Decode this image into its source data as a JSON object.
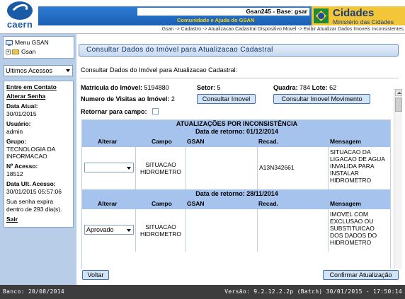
{
  "header": {
    "logo_text": "caern",
    "system_title": "Gsan245 - Base: gsar",
    "community_link": "Comunidade e Ajuda do GSAN",
    "ministry_name": "Cidades",
    "ministry_sub": "Ministério das Cidades",
    "breadcrumb": "Gsan -> Cadastro -> Atualizacao Cadastral Dispositivo Movel -> Exibir Atualizar Dados Imoveis Inconsistentes"
  },
  "sidebar": {
    "menu_root": "Menu GSAN",
    "menu_child": "Gsan",
    "recent_select": "Ultimos Acessos",
    "contact_link": "Entre em Contato",
    "change_password_link": "Alterar Senha",
    "date_label": "Data Atual:",
    "date_value": "30/01/2015",
    "user_label": "Usuário:",
    "user_value": "admin",
    "group_label": "Grupo:",
    "group_value_1": "TECNOLOGIA DA",
    "group_value_2": "INFORMACAO",
    "access_count_label": "Nº Acesso:",
    "access_count_value": "18512",
    "last_access_label": "Data Ult. Acesso:",
    "last_access_value": "30/01/2015 05:57:06",
    "password_expiry_1": "Sua senha expira",
    "password_expiry_2": "dentro de 293 dia(s).",
    "logout_link": "Sair"
  },
  "main": {
    "panel_title": "Consultar Dados do Imóvel para Atualizacao Cadastral",
    "subtitle": "Consultar Dados do Imóvel para Atualizacao Cadastral:",
    "matricula_label": "Matricula do Imóvel:",
    "matricula_value": "5194880",
    "setor_label": "Setor:",
    "setor_value": "5",
    "quadra_label": "Quadra:",
    "quadra_value": "784",
    "lote_label": "Lote:",
    "lote_value": "62",
    "visits_label": "Numero de Visitas ao Imóvel:",
    "visits_value": "2",
    "btn_consultar_imovel": "Consultar Imovel",
    "btn_consultar_movimento": "Consultar Imovel Movimento",
    "return_label": "Retornar para campo:",
    "table": {
      "title": "ATUALIZAÇÕES POR INCONSISTÊNCIA",
      "groups": [
        {
          "date_header": "Data de retorno: 01/12/2014",
          "headers": [
            "Alterar",
            "Campo",
            "GSAN",
            "Recad.",
            "Mensagem"
          ],
          "row": {
            "alterar": "",
            "campo_1": "SITUACAO",
            "campo_2": "HIDROMETRO",
            "gsan": "",
            "recad": "A13N342661",
            "mensagem_1": "SITUACAO DA",
            "mensagem_2": "LIGACAO DE AGUA",
            "mensagem_3": "INVALIDA PARA",
            "mensagem_4": "INSTALAR",
            "mensagem_5": "HIDROMETRO"
          }
        },
        {
          "date_header": "Data de retorno: 28/11/2014",
          "headers": [
            "Alterar",
            "Campo",
            "GSAN",
            "Recad.",
            "Mensagem"
          ],
          "row": {
            "alterar": "Aprovado",
            "campo_1": "SITUACAO",
            "campo_2": "HIDROMETRO",
            "gsan": "",
            "recad": "",
            "mensagem_1": "IMOVEL COM",
            "mensagem_2": "EXCLUSAO OU",
            "mensagem_3": "SUBSTITUICAO",
            "mensagem_4": "DOS DADOS DO",
            "mensagem_5": "HIDROMETRO"
          }
        }
      ]
    },
    "btn_voltar": "Voltar",
    "btn_confirmar": "Confirmar Atualização"
  },
  "footer": {
    "left": "Banco: 20/08/2014",
    "right": "Versão: 9.2.12.2.2p (Batch) 30/01/2015 - 17:50:14"
  },
  "colors": {
    "header_blue": "#1a5fb4",
    "sidebar_blue": "#b7cde8",
    "table_header_blue": "#a5c3ec",
    "footer_dark": "#3d3d3d",
    "ministry_yellow": "#f3c63a"
  }
}
